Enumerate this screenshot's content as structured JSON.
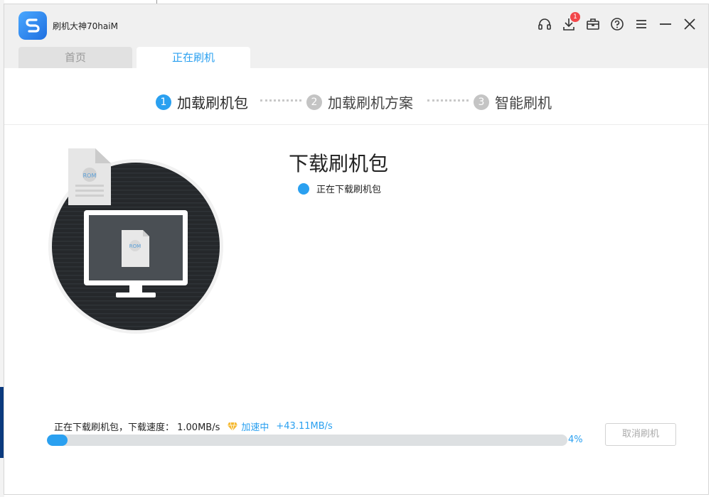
{
  "app": {
    "title": "刷机大神70haiM"
  },
  "titlebar": {
    "icons": [
      "headset-icon",
      "download-icon",
      "toolbox-icon",
      "help-icon",
      "menu-icon",
      "minimize-icon",
      "close-icon"
    ],
    "download_badge": "1"
  },
  "tabs": [
    {
      "label": "首页",
      "active": false
    },
    {
      "label": "正在刷机",
      "active": true
    }
  ],
  "steps": [
    {
      "num": "1",
      "label": "加载刷机包",
      "active": true
    },
    {
      "num": "2",
      "label": "加载刷机方案",
      "active": false
    },
    {
      "num": "3",
      "label": "智能刷机",
      "active": false
    }
  ],
  "illustration": {
    "rom_label": "ROM"
  },
  "main": {
    "headline": "下载刷机包",
    "status": "正在下载刷机包"
  },
  "download": {
    "info": "正在下载刷机包，下载速度： 1.00MB/s",
    "accel_label": "加速中",
    "accel_speed": "+43.11MB/s",
    "percent_label": "4%",
    "progress_fraction": 0.04
  },
  "buttons": {
    "cancel": "取消刷机"
  },
  "colors": {
    "accent": "#2aa0f0",
    "badge": "#f2474a",
    "ring_dark": "#25282b"
  }
}
